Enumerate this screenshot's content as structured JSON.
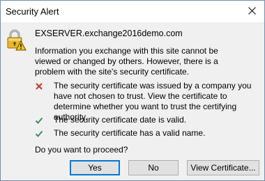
{
  "window": {
    "title": "Security Alert"
  },
  "dialog": {
    "host": "EXSERVER.exchange2016demo.com",
    "info": "Information you exchange with this site cannot be viewed or changed by others. However, there is a problem with the site's security certificate.",
    "checks": [
      {
        "status": "error",
        "icon": "red-x-icon",
        "text": "The security certificate was issued by a company you have not chosen to trust. View the certificate to determine whether you want to trust the certifying authority."
      },
      {
        "status": "ok",
        "icon": "green-check-icon",
        "text": "The security certificate date is valid."
      },
      {
        "status": "ok",
        "icon": "green-check-icon",
        "text": "The security certificate has a valid name."
      }
    ],
    "question": "Do you want to proceed?"
  },
  "buttons": {
    "yes": "Yes",
    "no": "No",
    "view": "View Certificate..."
  },
  "colors": {
    "accent": "#0078d7",
    "error": "#c0392b",
    "ok": "#3c8f5a",
    "button_bg": "#e1e1e1",
    "dialog_bg": "#f0f0f0"
  }
}
